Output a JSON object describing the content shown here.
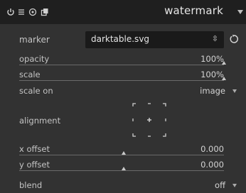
{
  "header": {
    "title": "watermark",
    "icons": [
      "power-icon",
      "presets-icon",
      "reset-icon",
      "copy-icon",
      "collapse-arrow-icon"
    ]
  },
  "marker": {
    "label": "marker",
    "value": "darktable.svg"
  },
  "opacity": {
    "label": "opacity",
    "value": "100%",
    "fraction": 1.0
  },
  "scale": {
    "label": "scale",
    "value": "100%",
    "fraction": 1.0
  },
  "scale_on": {
    "label": "scale on",
    "value": "image"
  },
  "alignment": {
    "label": "alignment",
    "selected": "center"
  },
  "x_offset": {
    "label": "x offset",
    "value": "0.000",
    "fraction": 0.5
  },
  "y_offset": {
    "label": "y offset",
    "value": "0.000",
    "fraction": 0.5
  },
  "blend": {
    "label": "blend",
    "value": "off"
  },
  "colors": {
    "header_bg": "#1f1f1f",
    "panel_bg": "#323232",
    "text": "#c8c8c8"
  }
}
